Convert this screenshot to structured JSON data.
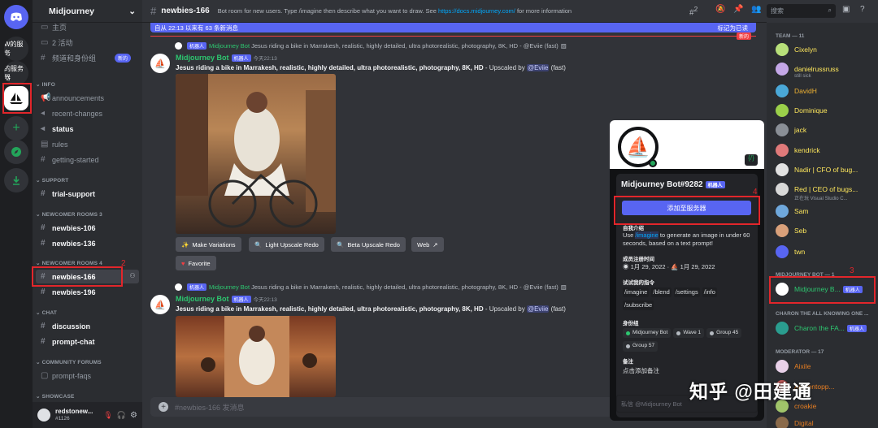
{
  "server": {
    "name": "Midjourney",
    "rail": [
      {
        "label": "W的服务"
      },
      {
        "label": "的服务器"
      }
    ]
  },
  "annotations": [
    "1",
    "2",
    "3",
    "4"
  ],
  "sidebar": {
    "top": [
      {
        "label": "主页"
      },
      {
        "label": "2 活动"
      },
      {
        "label": "频道和身份组",
        "badge": "新的"
      }
    ],
    "cat_info": "INFO",
    "info": [
      "announcements",
      "recent-changes",
      "status",
      "rules",
      "getting-started"
    ],
    "cat_support": "SUPPORT",
    "support": [
      "trial-support"
    ],
    "cat_rooms3": "NEWCOMER ROOMS 3",
    "rooms3": [
      "newbies-106",
      "newbies-136"
    ],
    "cat_rooms4": "NEWCOMER ROOMS 4",
    "rooms4": [
      "newbies-166",
      "newbies-196"
    ],
    "cat_chat": "CHAT",
    "chat": [
      "discussion",
      "prompt-chat"
    ],
    "cat_forums": "COMMUNITY FORUMS",
    "forums": [
      "prompt-faqs"
    ],
    "cat_showcase": "SHOWCASE"
  },
  "user": {
    "name": "redstonew...",
    "tag": "#1126"
  },
  "channel": {
    "name": "newbies-166",
    "topic_pre": "Bot room for new users. Type /imagine then describe what you want to draw. See ",
    "topic_link": "https://docs.midjourney.com/",
    "topic_post": " for more information"
  },
  "search": {
    "placeholder": "搜索"
  },
  "toolbar": {
    "threads_count": "2"
  },
  "newbar": {
    "text": "自从 22:13 以来有 63 条新消息",
    "mark": "标记为已读",
    "new": "新的"
  },
  "messages": [
    {
      "ref_name": "Midjourney Bot",
      "ref_text": "Jesus riding a bike in Marrakesh, realistic, highly detailed, ultra photorealistic, photography, 8K, HD - @Eviie (fast)",
      "author": "Midjourney Bot",
      "bot": "机器人",
      "time": "今天22:13",
      "prompt": "Jesus riding a bike in Marrakesh, realistic, highly detailed, ultra photorealistic, photography, 8K, HD",
      "suffix_pre": " - Upscaled by ",
      "mention": "@Eviie",
      "suffix_post": " (fast)"
    },
    {
      "ref_name": "Midjourney Bot",
      "ref_text": "Jesus riding a bike in Marrakesh, realistic, highly detailed, ultra photorealistic, photography, 8K, HD - @Eviie (fast)",
      "author": "Midjourney Bot",
      "bot": "机器人",
      "time": "今天22:13",
      "prompt": "Jesus riding a bike in Marrakesh, realistic, highly detailed, ultra photorealistic, photography, 8K, HD",
      "suffix_pre": " - Upscaled by ",
      "mention": "@Eviie",
      "suffix_post": " (fast)"
    }
  ],
  "buttons": {
    "variations": "Make Variations",
    "light": "Light Upscale Redo",
    "beta": "Beta Upscale Redo",
    "web": "Web",
    "favorite": "Favorite"
  },
  "composer": {
    "placeholder": "#newbies-166 发消息"
  },
  "profile": {
    "name": "Midjourney Bot#9282",
    "bot": "机器人",
    "add": "添加至服务器",
    "about_title": "自我介绍",
    "about_pre": "Use ",
    "about_cmd": "/imagine",
    "about_post": " to generate an image in under 60 seconds, based on a text prompt!",
    "member_since_title": "成员注册时间",
    "date1": "1月 29, 2022",
    "date2": "1月 29, 2022",
    "commands_title": "试试我的指令",
    "commands": [
      "/imagine",
      "/blend",
      "/settings",
      "/info",
      "/subscribe"
    ],
    "roles_title": "身份组",
    "roles": [
      {
        "name": "Midjourney Bot",
        "color": "#2dc770"
      },
      {
        "name": "Wave 1",
        "color": "#b5bac1"
      },
      {
        "name": "Group 45",
        "color": "#b5bac1"
      },
      {
        "name": "Group 57",
        "color": "#b5bac1"
      }
    ],
    "note_title": "备注",
    "note_hint": "点击添加备注",
    "dm_placeholder": "私信 @Midjourney Bot"
  },
  "members": {
    "team_title": "TEAM — 11",
    "team": [
      {
        "name": "Cixelyn",
        "color": "#fee75c"
      },
      {
        "name": "danielrussruss",
        "sub": "still sick",
        "color": "#fee75c"
      },
      {
        "name": "DavidH",
        "color": "#f0b232"
      },
      {
        "name": "Dominique",
        "color": "#fee75c"
      },
      {
        "name": "jack",
        "color": "#fee75c"
      },
      {
        "name": "kendrick",
        "color": "#fee75c"
      },
      {
        "name": "Nadir | CFO of bug...",
        "color": "#fee75c"
      },
      {
        "name": "Red | CEO of bugs...",
        "sub": "正在玩 Visual Studio C...",
        "color": "#fee75c"
      },
      {
        "name": "Sam",
        "color": "#fee75c"
      },
      {
        "name": "Seb",
        "color": "#fee75c"
      },
      {
        "name": "twn",
        "color": "#fee75c"
      }
    ],
    "bot_title": "MIDJOURNEY BOT — 1",
    "bot": {
      "name": "Midjourney B...",
      "tag": "机器人"
    },
    "charon_title": "CHARON THE ALL KNOWING ONE ...",
    "charon": {
      "name": "Charon the FA...",
      "tag": "机器人"
    },
    "mod_title": "MODERATOR — 17",
    "mods": [
      {
        "name": "Aixile",
        "color": "#e67e22"
      },
      {
        "name": "Ancientopp...",
        "color": "#e67e22"
      },
      {
        "name": "croakie",
        "color": "#e67e22"
      },
      {
        "name": "Digital",
        "color": "#e67e22"
      }
    ]
  },
  "watermark": "知乎 @田建通"
}
